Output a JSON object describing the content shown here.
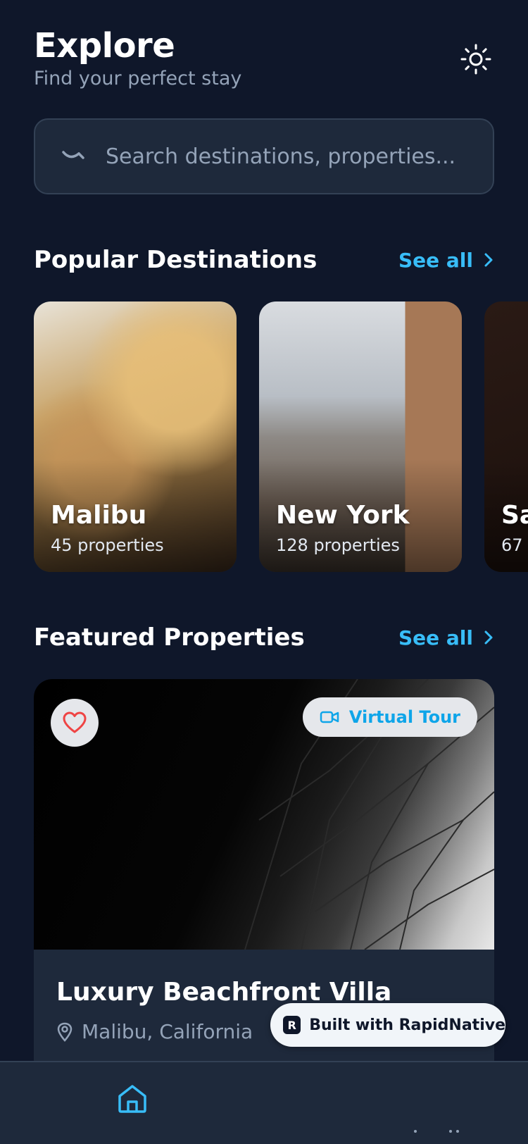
{
  "header": {
    "title": "Explore",
    "subtitle": "Find your perfect stay",
    "theme_icon": "sun-icon"
  },
  "search": {
    "placeholder": "Search destinations, properties..."
  },
  "popular": {
    "title": "Popular Destinations",
    "see_all": "See all",
    "items": [
      {
        "name": "Malibu",
        "count": "45 properties"
      },
      {
        "name": "New York",
        "count": "128 properties"
      },
      {
        "name": "Sa",
        "count": "67"
      }
    ]
  },
  "featured": {
    "title": "Featured Properties",
    "see_all": "See all",
    "card": {
      "badge": "Virtual Tour",
      "name": "Luxury Beachfront Villa",
      "location": "Malibu, California"
    }
  },
  "built_with": {
    "label": "Built with RapidNative"
  },
  "colors": {
    "background": "#0f172a",
    "surface": "#1e293b",
    "accent": "#38bdf8",
    "muted": "#94a3b8",
    "heart": "#ef4444"
  }
}
